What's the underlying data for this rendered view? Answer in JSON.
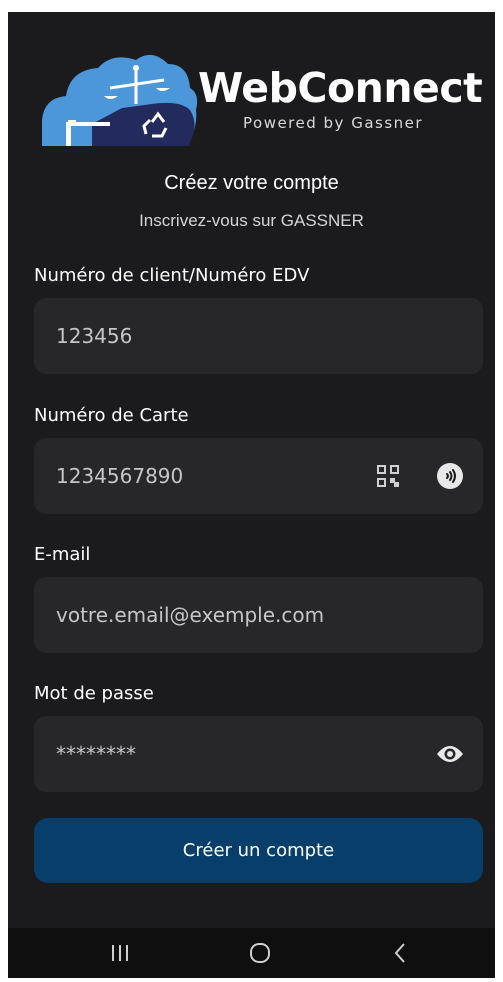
{
  "brand": {
    "title": "WebConnect",
    "subtitle": "Powered by Gassner",
    "colors": {
      "cloud": "#4b97d9",
      "cloud_dark": "#232a5e",
      "accent_button": "#073f6a"
    }
  },
  "header": {
    "headline": "Créez votre compte",
    "subline": "Inscrivez-vous sur GASSNER"
  },
  "form": {
    "client_number": {
      "label": "Numéro de client/Numéro EDV",
      "placeholder": "123456"
    },
    "card_number": {
      "label": "Numéro de Carte",
      "placeholder": "1234567890",
      "icons": [
        "qr-code-icon",
        "nfc-icon"
      ]
    },
    "email": {
      "label": "E-mail",
      "placeholder": "votre.email@exemple.com"
    },
    "password": {
      "label": "Mot de passe",
      "placeholder": "********",
      "icons": [
        "eye-icon"
      ]
    },
    "submit_label": "Créer un compte"
  },
  "navbar": {
    "icons": [
      "recent-apps-icon",
      "home-icon",
      "back-icon"
    ]
  }
}
